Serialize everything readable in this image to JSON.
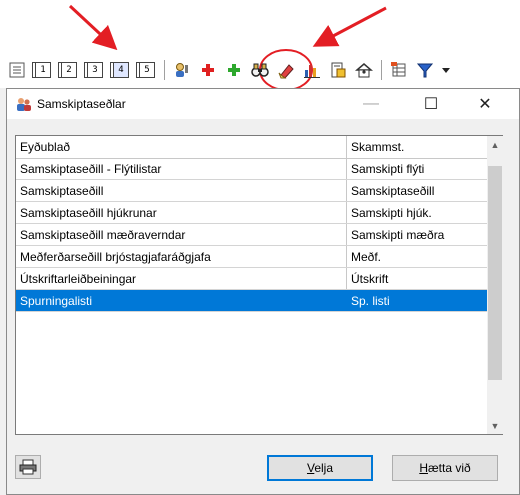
{
  "toolbar": {
    "nums": [
      "1",
      "2",
      "3",
      "4",
      "5"
    ],
    "active_num_index": 3
  },
  "dialog": {
    "title": "Samskiptaseðlar"
  },
  "list": {
    "columns": [
      "Eyðublað",
      "Skammst."
    ],
    "rows": [
      {
        "name": "Samskiptaseðill - Flýtilistar",
        "abbr": "Samskipti flýti"
      },
      {
        "name": "Samskiptaseðill",
        "abbr": "Samskiptaseðill"
      },
      {
        "name": "Samskiptaseðill hjúkrunar",
        "abbr": "Samskipti hjúk."
      },
      {
        "name": "Samskiptaseðill mæðraverndar",
        "abbr": "Samskipti mæðra"
      },
      {
        "name": "Meðferðarseðill brjóstagjafaráðgjafa",
        "abbr": "Meðf."
      },
      {
        "name": "Útskriftarleiðbeiningar",
        "abbr": "Útskrift"
      },
      {
        "name": "Spurningalisti",
        "abbr": "Sp. listi"
      }
    ],
    "selected_index": 6
  },
  "buttons": {
    "velja": {
      "mnemonic": "V",
      "rest": "elja"
    },
    "haetta": {
      "mnemonic": "H",
      "rest": "ætta við"
    }
  },
  "colors": {
    "selection": "#0078d7",
    "annotation_red": "#e31e24"
  },
  "icons": [
    "form-stack-icon",
    "person-key-icon",
    "add-red-icon",
    "add-green-icon",
    "binoculars-icon",
    "eraser-icon",
    "chart-icon",
    "document-clip-icon",
    "home-person-icon",
    "grid-icon",
    "filter-icon",
    "dropdown-arrow-icon",
    "print-icon",
    "app-people-icon"
  ]
}
